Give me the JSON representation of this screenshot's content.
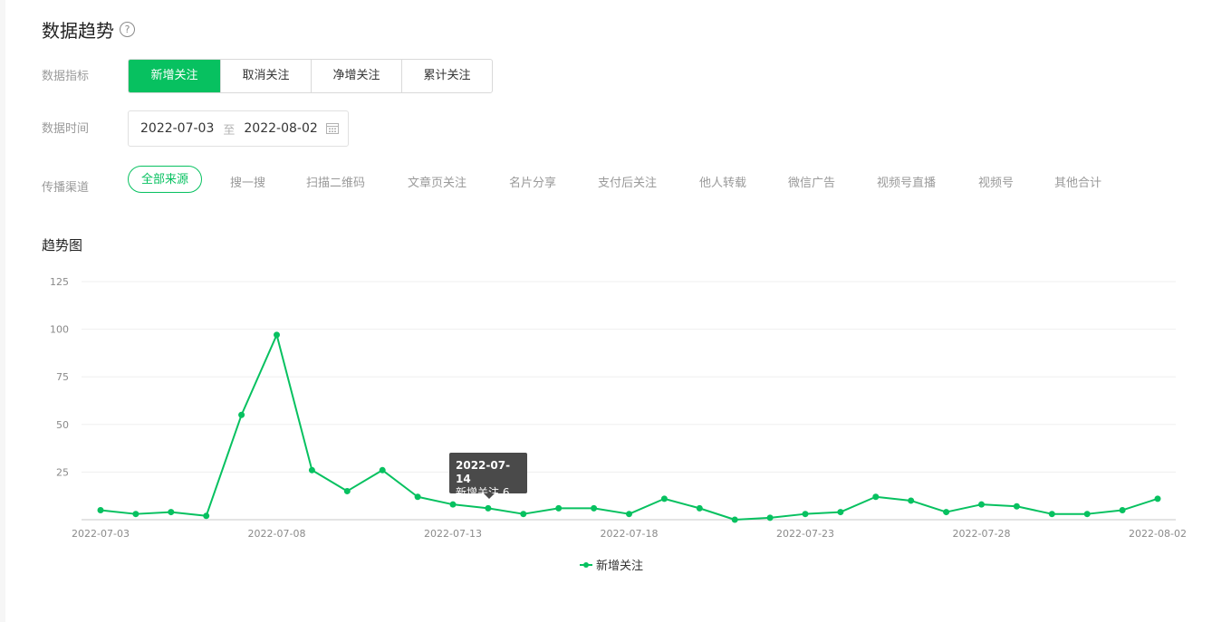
{
  "page": {
    "title": "数据趋势",
    "help_icon": "?"
  },
  "filters": {
    "metric_label": "数据指标",
    "metrics": [
      "新增关注",
      "取消关注",
      "净增关注",
      "累计关注"
    ],
    "active_metric": "新增关注",
    "time_label": "数据时间",
    "date_start": "2022-07-03",
    "date_separator": "至",
    "date_end": "2022-08-02",
    "channel_label": "传播渠道",
    "channels": [
      "全部来源",
      "搜一搜",
      "扫描二维码",
      "文章页关注",
      "名片分享",
      "支付后关注",
      "他人转载",
      "微信广告",
      "视频号直播",
      "视频号",
      "其他合计"
    ],
    "active_channel": "全部来源"
  },
  "section": {
    "title": "趋势图"
  },
  "tooltip": {
    "date": "2022-07-14",
    "text": "新增关注 6"
  },
  "colors": {
    "accent": "#07c160"
  },
  "chart_data": {
    "type": "line",
    "x": [
      "2022-07-03",
      "2022-07-04",
      "2022-07-05",
      "2022-07-06",
      "2022-07-07",
      "2022-07-08",
      "2022-07-09",
      "2022-07-10",
      "2022-07-11",
      "2022-07-12",
      "2022-07-13",
      "2022-07-14",
      "2022-07-15",
      "2022-07-16",
      "2022-07-17",
      "2022-07-18",
      "2022-07-19",
      "2022-07-20",
      "2022-07-21",
      "2022-07-22",
      "2022-07-23",
      "2022-07-24",
      "2022-07-25",
      "2022-07-26",
      "2022-07-27",
      "2022-07-28",
      "2022-07-29",
      "2022-07-30",
      "2022-07-31",
      "2022-08-01",
      "2022-08-02"
    ],
    "x_ticks": [
      "2022-07-03",
      "2022-07-08",
      "2022-07-13",
      "2022-07-18",
      "2022-07-23",
      "2022-07-28",
      "2022-08-02"
    ],
    "series": [
      {
        "name": "新增关注",
        "values": [
          5,
          3,
          4,
          2,
          55,
          97,
          26,
          15,
          26,
          12,
          8,
          6,
          3,
          6,
          6,
          3,
          11,
          6,
          0,
          1,
          3,
          4,
          12,
          10,
          4,
          8,
          7,
          3,
          3,
          5,
          11
        ]
      }
    ],
    "y_ticks": [
      25,
      50,
      75,
      100,
      125
    ],
    "ylim": [
      0,
      125
    ],
    "grid": true,
    "legend": "bottom-center",
    "title": "",
    "xlabel": "",
    "ylabel": ""
  }
}
